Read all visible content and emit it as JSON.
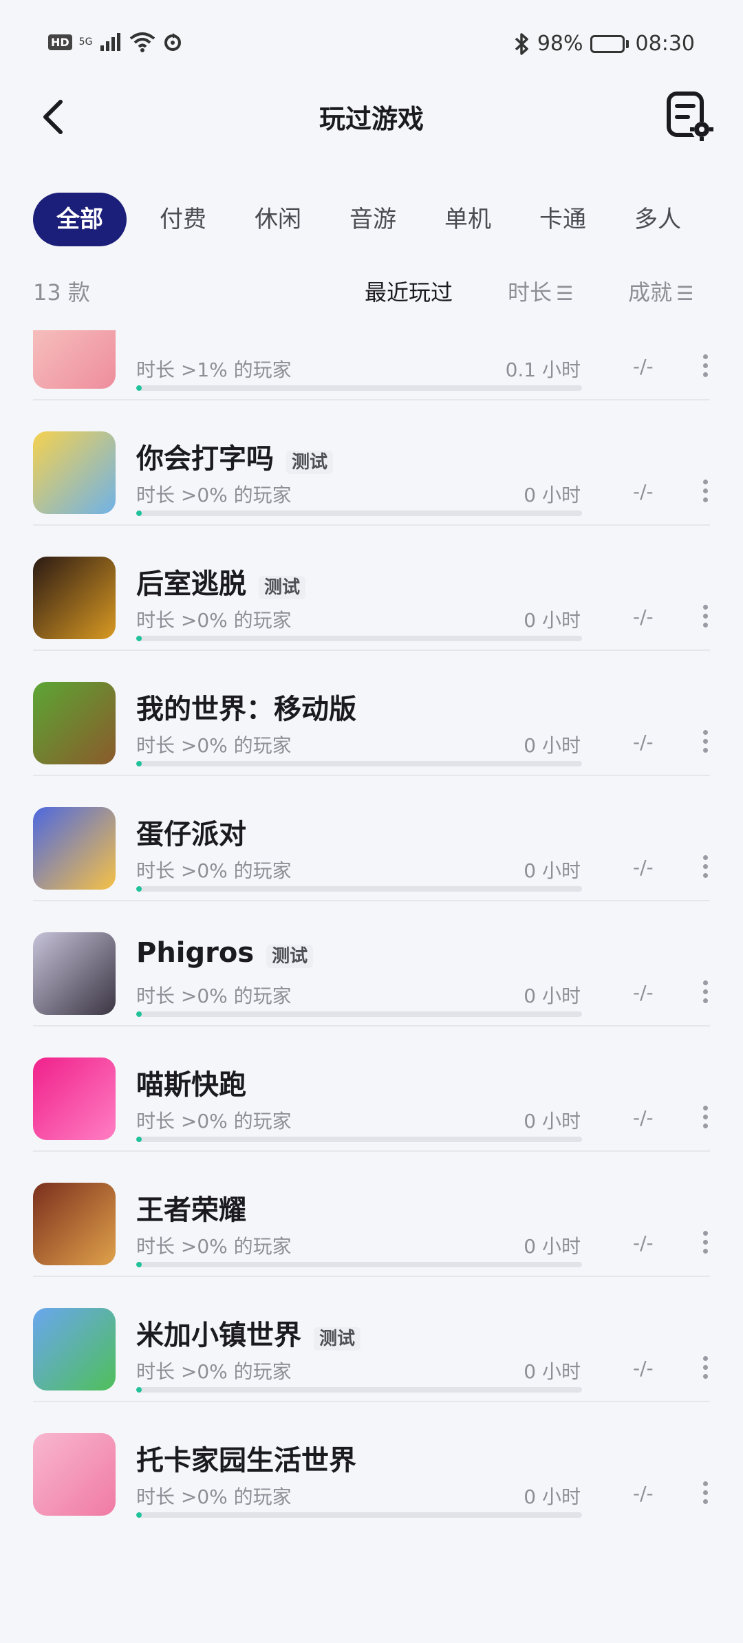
{
  "status": {
    "hd": "HD",
    "network": "5G",
    "battery": "98%",
    "battery_level": 0.98,
    "time": "08:30"
  },
  "header": {
    "title": "玩过游戏"
  },
  "tabs": [
    {
      "label": "全部"
    },
    {
      "label": "付费"
    },
    {
      "label": "休闲"
    },
    {
      "label": "音游"
    },
    {
      "label": "单机"
    },
    {
      "label": "卡通"
    },
    {
      "label": "多人"
    }
  ],
  "sort": {
    "count": "13 款",
    "recent": "最近玩过",
    "duration": "时长",
    "achievement": "成就"
  },
  "games": [
    {
      "name": "",
      "tag": "",
      "stat": "时长 >1% 的玩家",
      "hours": "0.1 小时",
      "achv": "-/-",
      "progress": 0.01,
      "icon": "game-icon-partial",
      "icon_colors": [
        "#f7c6c2",
        "#ee8d9c"
      ]
    },
    {
      "name": "你会打字吗",
      "tag": "测试",
      "stat": "时长 >0% 的玩家",
      "hours": "0 小时",
      "achv": "-/-",
      "progress": 0.0,
      "icon": "typing-game-icon",
      "icon_colors": [
        "#f5d14f",
        "#6fb2e7"
      ]
    },
    {
      "name": "后室逃脱",
      "tag": "测试",
      "stat": "时长 >0% 的玩家",
      "hours": "0 小时",
      "achv": "-/-",
      "progress": 0.0,
      "icon": "backrooms-icon",
      "icon_colors": [
        "#2b1a14",
        "#d99a22"
      ]
    },
    {
      "name": "我的世界：移动版",
      "tag": "",
      "stat": "时长 >0% 的玩家",
      "hours": "0 小时",
      "achv": "-/-",
      "progress": 0.0,
      "icon": "minecraft-icon",
      "icon_colors": [
        "#5ba635",
        "#8b5a2b"
      ]
    },
    {
      "name": "蛋仔派对",
      "tag": "",
      "stat": "时长 >0% 的玩家",
      "hours": "0 小时",
      "achv": "-/-",
      "progress": 0.0,
      "icon": "eggy-party-icon",
      "icon_colors": [
        "#4d68e0",
        "#f6c146"
      ]
    },
    {
      "name": "Phigros",
      "tag": "测试",
      "stat": "时长 >0% 的玩家",
      "hours": "0 小时",
      "achv": "-/-",
      "progress": 0.0,
      "icon": "phigros-icon",
      "icon_colors": [
        "#c6c2d8",
        "#3b3543"
      ]
    },
    {
      "name": "喵斯快跑",
      "tag": "",
      "stat": "时长 >0% 的玩家",
      "hours": "0 小时",
      "achv": "-/-",
      "progress": 0.0,
      "icon": "muse-dash-icon",
      "icon_colors": [
        "#f0218b",
        "#ff7ec3"
      ]
    },
    {
      "name": "王者荣耀",
      "tag": "",
      "stat": "时长 >0% 的玩家",
      "hours": "0 小时",
      "achv": "-/-",
      "progress": 0.0,
      "icon": "honor-of-kings-icon",
      "icon_colors": [
        "#7b2f1d",
        "#e0a24b"
      ]
    },
    {
      "name": "米加小镇世界",
      "tag": "测试",
      "stat": "时长 >0% 的玩家",
      "hours": "0 小时",
      "achv": "-/-",
      "progress": 0.0,
      "icon": "miga-town-icon",
      "icon_colors": [
        "#6aa6ef",
        "#4fbf5a"
      ]
    },
    {
      "name": "托卡家园生活世界",
      "tag": "",
      "stat": "时长 >0% 的玩家",
      "hours": "0 小时",
      "achv": "-/-",
      "progress": 0.0,
      "icon": "toca-life-icon",
      "icon_colors": [
        "#f8b7cf",
        "#f07aa3"
      ]
    }
  ]
}
